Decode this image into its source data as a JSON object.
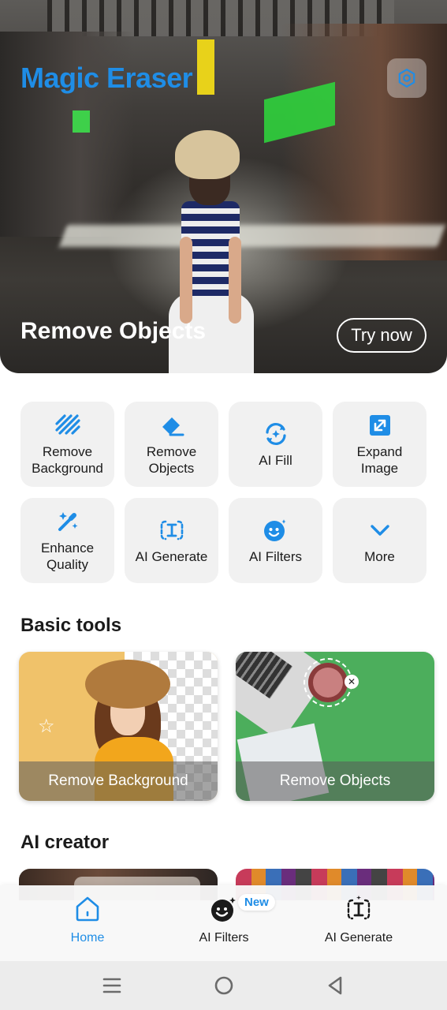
{
  "hero": {
    "app_title": "Magic Eraser",
    "caption": "Remove Objects",
    "cta_label": "Try now",
    "accent_color": "#1f8de6"
  },
  "tools": [
    {
      "label": "Remove\nBackground",
      "icon": "stripes-icon"
    },
    {
      "label": "Remove\nObjects",
      "icon": "eraser-icon"
    },
    {
      "label": "AI Fill",
      "icon": "refresh-sparkle-icon"
    },
    {
      "label": "Expand\nImage",
      "icon": "expand-image-icon"
    },
    {
      "label": "Enhance\nQuality",
      "icon": "magic-wand-icon"
    },
    {
      "label": "AI Generate",
      "icon": "text-cursor-icon"
    },
    {
      "label": "AI Filters",
      "icon": "smiley-sparkle-icon"
    },
    {
      "label": "More",
      "icon": "chevron-down-icon"
    }
  ],
  "sections": {
    "basic_tools": "Basic tools",
    "ai_creator": "AI creator"
  },
  "basic_cards": [
    {
      "label": "Remove Background"
    },
    {
      "label": "Remove Objects"
    }
  ],
  "bottom_nav": {
    "items": [
      {
        "label": "Home",
        "icon": "home-icon",
        "active": true
      },
      {
        "label": "AI Filters",
        "icon": "smiley-sparkle-icon",
        "active": false
      },
      {
        "label": "AI Generate",
        "icon": "text-cursor-icon",
        "active": false
      }
    ],
    "new_badge": "New"
  },
  "system_nav": [
    "menu-icon",
    "home-circle-icon",
    "back-icon"
  ]
}
